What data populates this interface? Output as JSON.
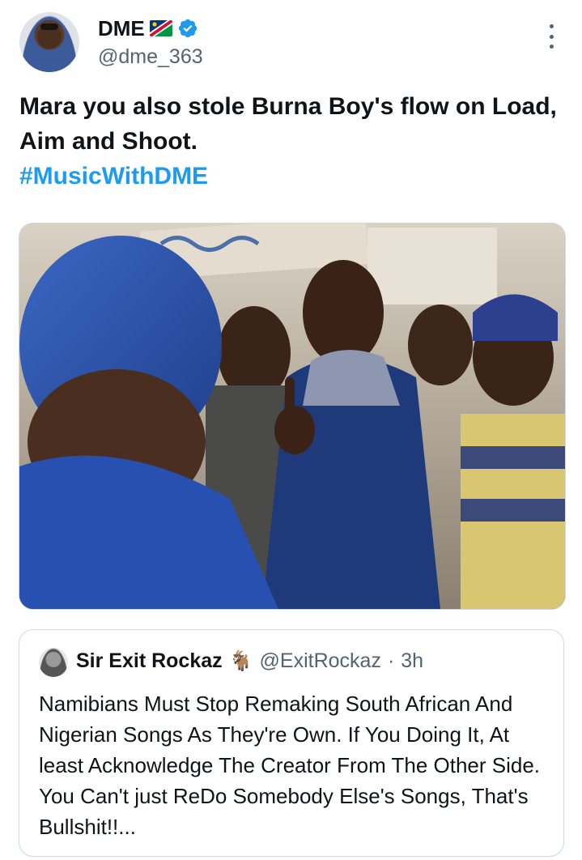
{
  "author": {
    "display_name": "DME",
    "handle": "@dme_363",
    "flag_icon": "namibia-flag-icon",
    "verified_icon": "verified-badge-icon"
  },
  "tweet": {
    "text": "Mara you also stole Burna Boy's flow on Load, Aim and Shoot.",
    "hashtag": "#MusicWithDME"
  },
  "media": {
    "description_icon": "protest-photo"
  },
  "quoted_tweet": {
    "display_name": "Sir Exit Rockaz",
    "emoji": "🐐",
    "handle": "@ExitRockaz",
    "separator": "·",
    "time": "3h",
    "text": "Namibians Must Stop Remaking South African And Nigerian Songs As They're Own. If You Doing It, At least Acknowledge The Creator From The Other Side. You Can't just ReDo Somebody Else's Songs, That's Bullshit!!..."
  },
  "colors": {
    "link": "#1d9bf0",
    "secondary_text": "#536471",
    "border": "#cfd9de"
  }
}
